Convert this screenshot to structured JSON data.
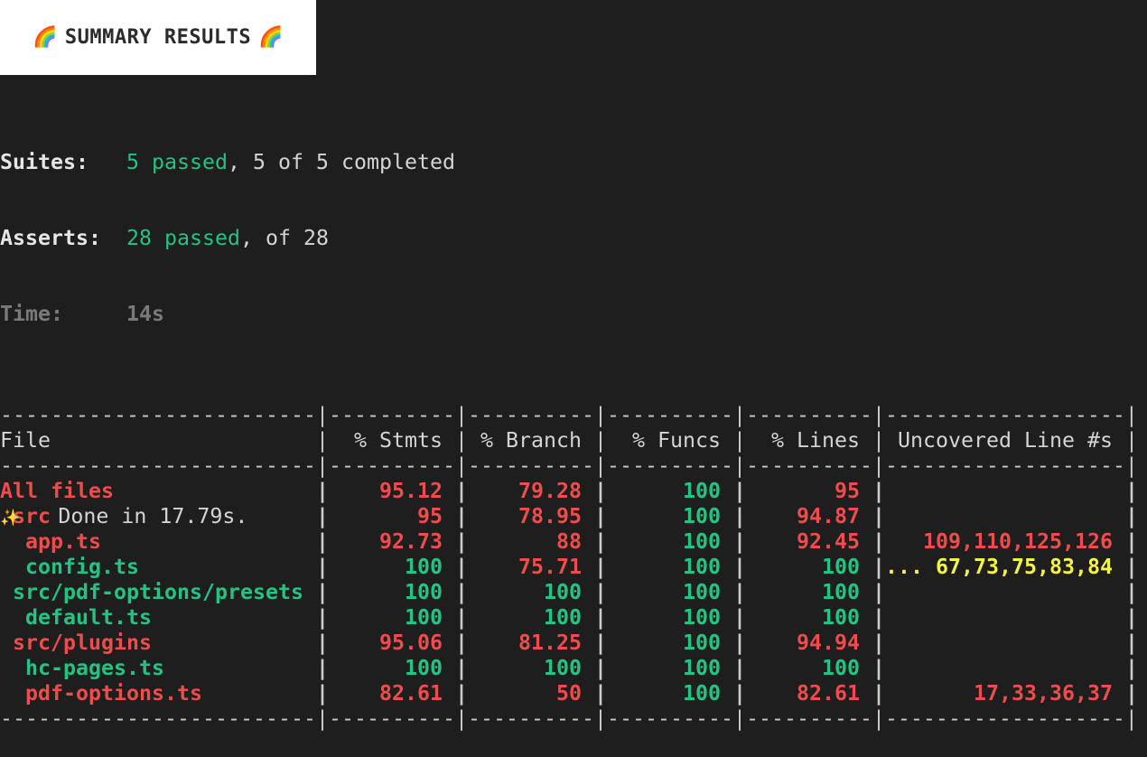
{
  "banner": {
    "icon_left": "🌈",
    "title": "SUMMARY RESULTS",
    "icon_right": "🌈",
    "icon_name": "rainbow-icon"
  },
  "summary": {
    "suites": {
      "label": "Suites:",
      "passed": "5 passed",
      "rest": ", 5 of 5 completed"
    },
    "asserts": {
      "label": "Asserts:",
      "passed": "28 passed",
      "rest": ", of 28"
    },
    "time": {
      "label": "Time:",
      "value": "14s"
    }
  },
  "table": {
    "separator_chars": {
      "file": "-------------------------",
      "num": "----------",
      "unc": "-------------------"
    },
    "headers": {
      "file": "File",
      "stmts": "% Stmts",
      "branch": "% Branch",
      "funcs": "% Funcs",
      "lines": "% Lines",
      "uncovered": "Uncovered Line #s"
    },
    "rows": [
      {
        "file": "All files",
        "indent": 0,
        "file_color": "red",
        "stmts": "95.12",
        "stmts_color": "red",
        "branch": "79.28",
        "branch_color": "red",
        "funcs": "100",
        "funcs_color": "green",
        "lines": "95",
        "lines_color": "red",
        "uncovered_prefix": "",
        "uncovered": "",
        "uncovered_color": "red"
      },
      {
        "file": "src",
        "indent": 1,
        "file_color": "red",
        "stmts": "95",
        "stmts_color": "red",
        "branch": "78.95",
        "branch_color": "red",
        "funcs": "100",
        "funcs_color": "green",
        "lines": "94.87",
        "lines_color": "red",
        "uncovered_prefix": "",
        "uncovered": "",
        "uncovered_color": "red"
      },
      {
        "file": "app.ts",
        "indent": 2,
        "file_color": "red",
        "stmts": "92.73",
        "stmts_color": "red",
        "branch": "88",
        "branch_color": "red",
        "funcs": "100",
        "funcs_color": "green",
        "lines": "92.45",
        "lines_color": "red",
        "uncovered_prefix": "",
        "uncovered": "109,110,125,126",
        "uncovered_color": "red"
      },
      {
        "file": "config.ts",
        "indent": 2,
        "file_color": "green",
        "stmts": "100",
        "stmts_color": "green",
        "branch": "75.71",
        "branch_color": "red",
        "funcs": "100",
        "funcs_color": "green",
        "lines": "100",
        "lines_color": "green",
        "uncovered_prefix": "...",
        "uncovered": "67,73,75,83,84",
        "uncovered_color": "yellow"
      },
      {
        "file": "src/pdf-options/presets",
        "indent": 1,
        "file_color": "green",
        "stmts": "100",
        "stmts_color": "green",
        "branch": "100",
        "branch_color": "green",
        "funcs": "100",
        "funcs_color": "green",
        "lines": "100",
        "lines_color": "green",
        "uncovered_prefix": "",
        "uncovered": "",
        "uncovered_color": "green"
      },
      {
        "file": "default.ts",
        "indent": 2,
        "file_color": "green",
        "stmts": "100",
        "stmts_color": "green",
        "branch": "100",
        "branch_color": "green",
        "funcs": "100",
        "funcs_color": "green",
        "lines": "100",
        "lines_color": "green",
        "uncovered_prefix": "",
        "uncovered": "",
        "uncovered_color": "green"
      },
      {
        "file": "src/plugins",
        "indent": 1,
        "file_color": "red",
        "stmts": "95.06",
        "stmts_color": "red",
        "branch": "81.25",
        "branch_color": "red",
        "funcs": "100",
        "funcs_color": "green",
        "lines": "94.94",
        "lines_color": "red",
        "uncovered_prefix": "",
        "uncovered": "",
        "uncovered_color": "red"
      },
      {
        "file": "hc-pages.ts",
        "indent": 2,
        "file_color": "green",
        "stmts": "100",
        "stmts_color": "green",
        "branch": "100",
        "branch_color": "green",
        "funcs": "100",
        "funcs_color": "green",
        "lines": "100",
        "lines_color": "green",
        "uncovered_prefix": "",
        "uncovered": "",
        "uncovered_color": "green"
      },
      {
        "file": "pdf-options.ts",
        "indent": 2,
        "file_color": "red",
        "stmts": "82.61",
        "stmts_color": "red",
        "branch": "50",
        "branch_color": "red",
        "funcs": "100",
        "funcs_color": "green",
        "lines": "82.61",
        "lines_color": "red",
        "uncovered_prefix": "",
        "uncovered": "17,33,36,37",
        "uncovered_color": "red"
      }
    ]
  },
  "footer": {
    "icon": "✨",
    "icon_name": "sparkles-icon",
    "text": "Done in 17.79s."
  },
  "colors": {
    "background": "#1e1e1e",
    "pass": "#23c483",
    "fail": "#f14c4c",
    "warn": "#f5f543",
    "dim": "#7a7a7a"
  }
}
